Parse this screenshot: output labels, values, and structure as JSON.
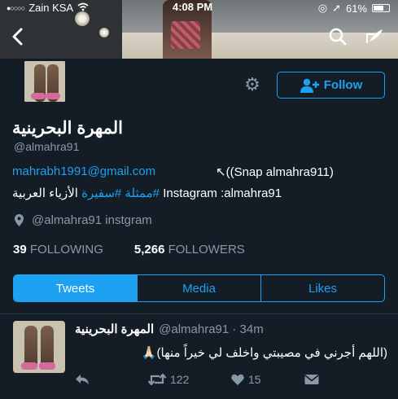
{
  "status_bar": {
    "carrier": "Zain KSA",
    "time": "4:08 PM",
    "battery": "61%"
  },
  "profile": {
    "display_name": "المهرة البحرينية",
    "handle": "@almahra91",
    "follow_label": "Follow",
    "bio_email": "mahrabh1991@gmail.com",
    "bio_snap": "((Snap almahra911)",
    "bio_instagram": "Instagram :almahra91",
    "bio_tags": "#ممثلة #سفيرة",
    "bio_tail": "الأزياء العربية",
    "location": "@almahra91 instgram",
    "following_count": "39",
    "following_label": "FOLLOWING",
    "followers_count": "5,266",
    "followers_label": "FOLLOWERS"
  },
  "tabs": [
    {
      "label": "Tweets",
      "active": true
    },
    {
      "label": "Media",
      "active": false
    },
    {
      "label": "Likes",
      "active": false
    }
  ],
  "tweet": {
    "name": "المهرة البحرينية",
    "handle_time": "@almahra91 · 34m",
    "text": "(اللهم أجرني في مصيبتي واخلف لي خيراً منها)🙏🏻",
    "retweets": "122",
    "likes": "15"
  },
  "colors": {
    "background": "#141d26",
    "accent": "#1da1f2",
    "secondary_text": "#8899a6"
  }
}
